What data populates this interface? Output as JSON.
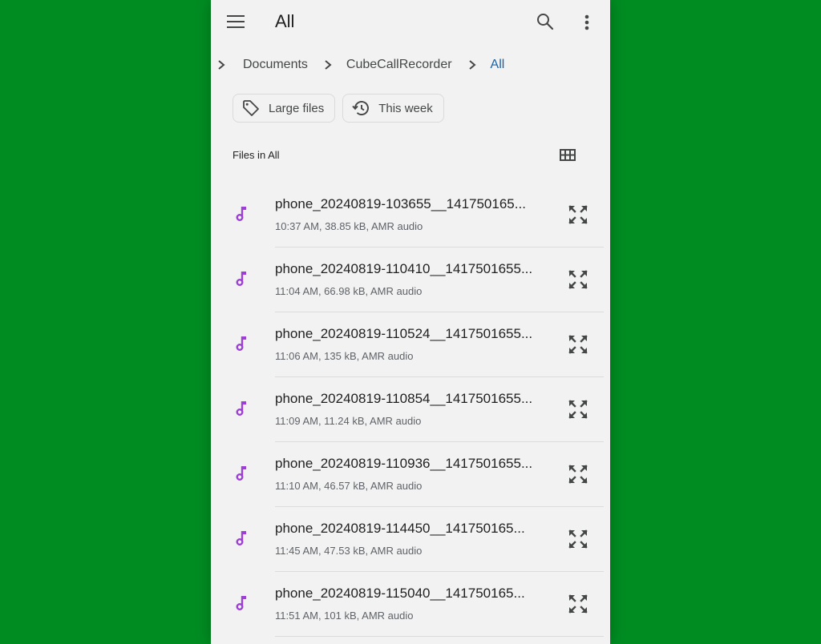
{
  "colors": {
    "background": "#018c22",
    "surface": "#f2f2f2",
    "accent_link": "#1a63a8",
    "music_icon": "#9b3fd6"
  },
  "topbar": {
    "menu_icon": "hamburger-menu-icon",
    "title": "All",
    "search_icon": "search-icon",
    "more_icon": "more-vert-icon"
  },
  "breadcrumb": {
    "items": [
      {
        "label": "Documents",
        "active": false
      },
      {
        "label": "CubeCallRecorder",
        "active": false
      },
      {
        "label": "All",
        "active": true
      }
    ]
  },
  "chips": [
    {
      "label": "Large files",
      "icon": "tag-icon"
    },
    {
      "label": "This week",
      "icon": "history-icon"
    }
  ],
  "section": {
    "title": "Files in All",
    "view_toggle_icon": "grid-view-icon"
  },
  "files": [
    {
      "name": "phone_20240819-103655__141750165...",
      "meta": "10:37 AM, 38.85 kB, AMR audio"
    },
    {
      "name": "phone_20240819-110410__1417501655...",
      "meta": "11:04 AM, 66.98 kB, AMR audio"
    },
    {
      "name": "phone_20240819-110524__1417501655...",
      "meta": "11:06 AM, 135 kB, AMR audio"
    },
    {
      "name": "phone_20240819-110854__1417501655...",
      "meta": "11:09 AM, 11.24 kB, AMR audio"
    },
    {
      "name": "phone_20240819-110936__1417501655...",
      "meta": "11:10 AM, 46.57 kB, AMR audio"
    },
    {
      "name": "phone_20240819-114450__141750165...",
      "meta": "11:45 AM, 47.53 kB, AMR audio"
    },
    {
      "name": "phone_20240819-115040__141750165...",
      "meta": "11:51 AM, 101 kB, AMR audio"
    }
  ]
}
